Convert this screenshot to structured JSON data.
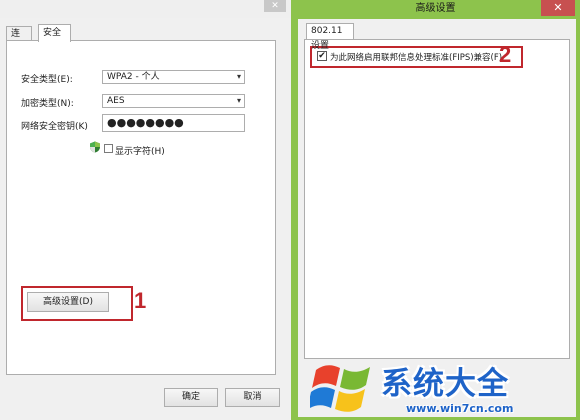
{
  "left_dialog": {
    "close_glyph": "✕",
    "tabs": [
      {
        "label": "连接"
      },
      {
        "label": "安全"
      }
    ],
    "fields": {
      "security_type": {
        "label": "安全类型(E):",
        "value": "WPA2 - 个人"
      },
      "encryption_type": {
        "label": "加密类型(N):",
        "value": "AES"
      },
      "network_key": {
        "label": "网络安全密钥(K)",
        "value": "●●●●●●●●"
      }
    },
    "show_chars_label": "显示字符(H)",
    "advanced_button_label": "高级设置(D)",
    "ok_label": "确定",
    "cancel_label": "取消",
    "marker": "1"
  },
  "right_dialog": {
    "title": "高级设置",
    "close_glyph": "✕",
    "tab_label": "802.11 设置",
    "fips_checked": true,
    "fips_check_glyph": "✔",
    "fips_label": "为此网络启用联邦信息处理标准(FIPS)兼容(F)",
    "marker": "2"
  },
  "watermark": {
    "title": "系统大全",
    "url": "www.win7cn.com"
  },
  "colors": {
    "accent_green": "#8dc34c",
    "highlight_red": "#c0272d",
    "close_red": "#c75050",
    "watermark_blue": "#1e63c8"
  },
  "icons": [
    "shield-icon",
    "dropdown-arrow-icon",
    "checkbox-icon",
    "windows-logo-icon",
    "close-icon"
  ]
}
